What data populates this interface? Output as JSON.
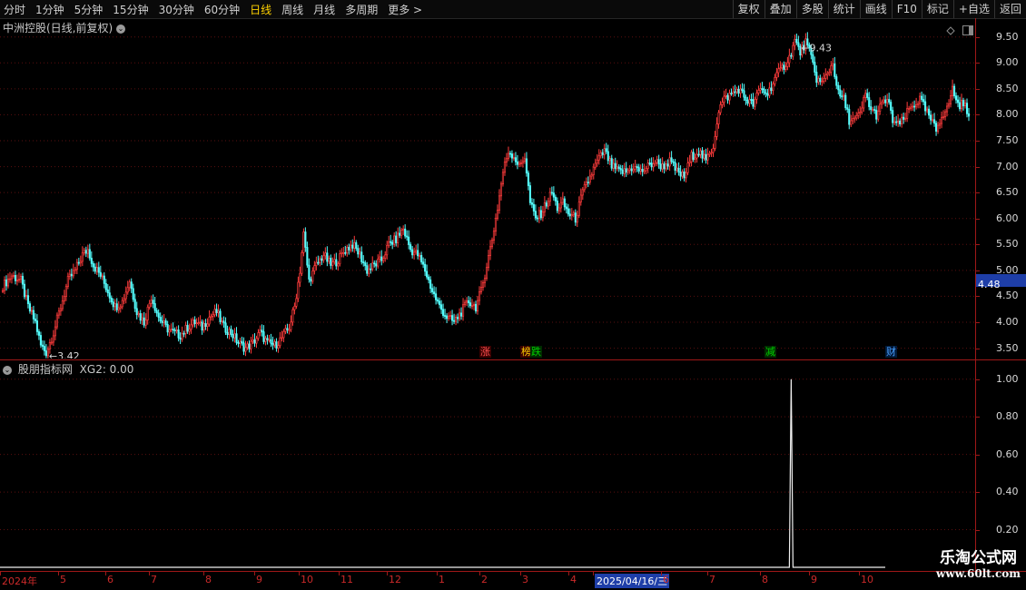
{
  "toolbar": {
    "periods": [
      "分时",
      "1分钟",
      "5分钟",
      "15分钟",
      "30分钟",
      "60分钟",
      "日线",
      "周线",
      "月线",
      "多周期",
      "更多 >"
    ],
    "active_period": "日线",
    "tools": [
      "复权",
      "叠加",
      "多股",
      "统计",
      "画线",
      "F10",
      "标记",
      "+自选",
      "返回"
    ]
  },
  "main_panel": {
    "title": "中洲控股(日线,前复权)",
    "current_price": "4.48",
    "high_label": "9.43",
    "low_label": "3.42",
    "y_ticks": [
      "9.50",
      "9.00",
      "8.50",
      "8.00",
      "7.50",
      "7.00",
      "6.50",
      "6.00",
      "5.50",
      "5.00",
      "4.50",
      "4.00",
      "3.50"
    ],
    "event_tags": [
      {
        "text": "涨",
        "color": "#ff5050",
        "bg": "#3a0000"
      },
      {
        "text": "榜",
        "color": "#ffd200",
        "bg": "#3a0000"
      },
      {
        "text": "跌",
        "color": "#00d000",
        "bg": "#002a00"
      },
      {
        "text": "减",
        "color": "#00d000",
        "bg": "#002a00"
      },
      {
        "text": "财",
        "color": "#4a9fff",
        "bg": "#001a3a"
      }
    ]
  },
  "sub_panel": {
    "title": "股朋指标网",
    "indicator": "XG2: 0.00",
    "y_ticks": [
      "1.00",
      "0.80",
      "0.60",
      "0.40",
      "0.20"
    ]
  },
  "x_axis": {
    "labels": [
      "2024年",
      "5",
      "6",
      "7",
      "8",
      "9",
      "10",
      "11",
      "12",
      "1",
      "2",
      "3",
      "4",
      "2025/04/16/三",
      "6",
      "7",
      "8",
      "9",
      "10"
    ],
    "cursor_date": "2025/04/16/三"
  },
  "watermark": {
    "line1": "乐淘公式网",
    "line2": "www.60lt.com"
  },
  "chart_data": {
    "type": "candlestick",
    "title": "中洲控股(日线,前复权)",
    "y_range": [
      3.3,
      9.6
    ],
    "approx_close_path": [
      [
        0,
        4.7
      ],
      [
        5,
        4.9
      ],
      [
        10,
        4.8
      ],
      [
        14,
        4.3
      ],
      [
        18,
        4.0
      ],
      [
        21,
        3.55
      ],
      [
        24,
        3.42
      ],
      [
        28,
        3.8
      ],
      [
        32,
        4.3
      ],
      [
        36,
        4.8
      ],
      [
        40,
        5.0
      ],
      [
        44,
        5.3
      ],
      [
        47,
        5.4
      ],
      [
        50,
        5.1
      ],
      [
        54,
        4.9
      ],
      [
        58,
        4.6
      ],
      [
        62,
        4.3
      ],
      [
        66,
        4.4
      ],
      [
        70,
        4.8
      ],
      [
        74,
        4.2
      ],
      [
        78,
        4.0
      ],
      [
        82,
        4.5
      ],
      [
        86,
        4.1
      ],
      [
        90,
        3.9
      ],
      [
        94,
        3.8
      ],
      [
        98,
        3.75
      ],
      [
        102,
        3.9
      ],
      [
        106,
        4.0
      ],
      [
        110,
        3.9
      ],
      [
        114,
        4.1
      ],
      [
        118,
        4.2
      ],
      [
        122,
        3.9
      ],
      [
        126,
        3.8
      ],
      [
        130,
        3.6
      ],
      [
        134,
        3.5
      ],
      [
        138,
        3.6
      ],
      [
        142,
        3.8
      ],
      [
        146,
        3.6
      ],
      [
        150,
        3.55
      ],
      [
        154,
        3.7
      ],
      [
        158,
        3.9
      ],
      [
        161,
        4.3
      ],
      [
        164,
        5.0
      ],
      [
        166,
        5.7
      ],
      [
        169,
        4.8
      ],
      [
        173,
        5.1
      ],
      [
        177,
        5.3
      ],
      [
        181,
        5.1
      ],
      [
        185,
        5.2
      ],
      [
        189,
        5.4
      ],
      [
        193,
        5.5
      ],
      [
        197,
        5.3
      ],
      [
        201,
        5.0
      ],
      [
        205,
        5.1
      ],
      [
        209,
        5.2
      ],
      [
        213,
        5.5
      ],
      [
        217,
        5.6
      ],
      [
        221,
        5.8
      ],
      [
        225,
        5.4
      ],
      [
        229,
        5.3
      ],
      [
        233,
        5.0
      ],
      [
        237,
        4.6
      ],
      [
        241,
        4.3
      ],
      [
        245,
        4.1
      ],
      [
        249,
        4.0
      ],
      [
        253,
        4.2
      ],
      [
        257,
        4.4
      ],
      [
        261,
        4.3
      ],
      [
        264,
        4.6
      ],
      [
        267,
        5.1
      ],
      [
        270,
        5.6
      ],
      [
        273,
        6.2
      ],
      [
        276,
        6.9
      ],
      [
        279,
        7.3
      ],
      [
        282,
        7.2
      ],
      [
        285,
        7.0
      ],
      [
        288,
        7.2
      ],
      [
        291,
        6.3
      ],
      [
        294,
        6.0
      ],
      [
        297,
        6.1
      ],
      [
        300,
        6.3
      ],
      [
        303,
        6.5
      ],
      [
        306,
        6.2
      ],
      [
        309,
        6.3
      ],
      [
        312,
        6.1
      ],
      [
        316,
        6.0
      ],
      [
        320,
        6.5
      ],
      [
        324,
        6.8
      ],
      [
        328,
        7.1
      ],
      [
        332,
        7.3
      ],
      [
        336,
        7.0
      ],
      [
        340,
        6.9
      ],
      [
        344,
        6.9
      ],
      [
        348,
        7.0
      ],
      [
        352,
        6.9
      ],
      [
        356,
        7.0
      ],
      [
        360,
        7.1
      ],
      [
        364,
        7.0
      ],
      [
        368,
        7.1
      ],
      [
        372,
        6.9
      ],
      [
        376,
        6.8
      ],
      [
        380,
        7.2
      ],
      [
        384,
        7.3
      ],
      [
        388,
        7.1
      ],
      [
        392,
        7.4
      ],
      [
        395,
        8.1
      ],
      [
        398,
        8.3
      ],
      [
        402,
        8.4
      ],
      [
        406,
        8.5
      ],
      [
        410,
        8.3
      ],
      [
        414,
        8.2
      ],
      [
        418,
        8.5
      ],
      [
        422,
        8.4
      ],
      [
        426,
        8.7
      ],
      [
        430,
        8.9
      ],
      [
        434,
        9.1
      ],
      [
        437,
        9.43
      ],
      [
        440,
        9.2
      ],
      [
        443,
        9.4
      ],
      [
        446,
        9.1
      ],
      [
        449,
        8.7
      ],
      [
        452,
        8.6
      ],
      [
        455,
        8.8
      ],
      [
        458,
        9.0
      ],
      [
        461,
        8.4
      ],
      [
        464,
        8.3
      ],
      [
        467,
        7.9
      ],
      [
        470,
        7.9
      ],
      [
        473,
        8.0
      ],
      [
        476,
        8.4
      ],
      [
        479,
        8.1
      ],
      [
        482,
        8.0
      ],
      [
        485,
        8.2
      ],
      [
        488,
        8.3
      ],
      [
        491,
        7.9
      ],
      [
        494,
        7.8
      ],
      [
        497,
        7.9
      ],
      [
        500,
        8.1
      ],
      [
        503,
        8.2
      ],
      [
        506,
        8.3
      ],
      [
        509,
        8.1
      ],
      [
        512,
        7.9
      ],
      [
        515,
        7.7
      ],
      [
        518,
        8.0
      ],
      [
        521,
        8.1
      ],
      [
        524,
        8.5
      ],
      [
        527,
        8.2
      ],
      [
        530,
        8.2
      ],
      [
        533,
        8.05
      ]
    ],
    "indicator": {
      "name": "XG2",
      "y_range": [
        0,
        1.0
      ],
      "spikes": [
        [
          435,
          1.0
        ]
      ]
    }
  }
}
